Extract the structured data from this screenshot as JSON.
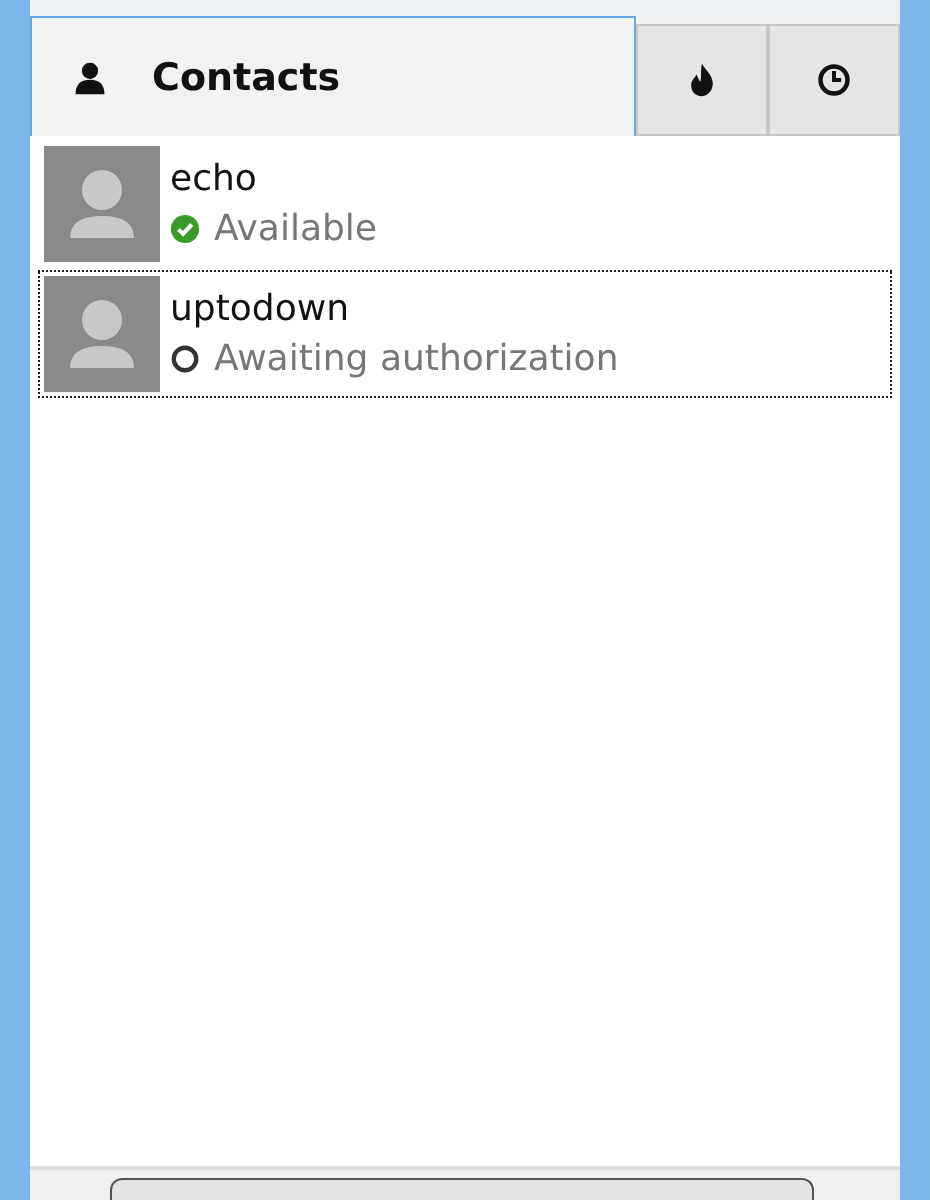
{
  "tabs": [
    {
      "label": "Contacts",
      "kind": "contacts",
      "selected": true
    },
    {
      "kind": "popular",
      "selected": false
    },
    {
      "kind": "recent",
      "selected": false
    }
  ],
  "contacts": [
    {
      "name": "echo",
      "status": "Available",
      "kind": "available",
      "selected": false
    },
    {
      "name": "uptodown",
      "status": "Awaiting authorization",
      "kind": "pending",
      "selected": true
    }
  ]
}
